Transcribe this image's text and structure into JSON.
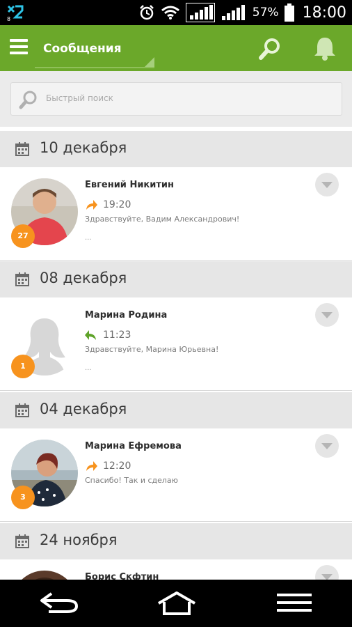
{
  "status_bar": {
    "battery_percent": "57%",
    "time": "18:00"
  },
  "app_bar": {
    "title": "Сообщения",
    "color": "#6ba82a"
  },
  "quick_search": {
    "placeholder": "Быстрый поиск"
  },
  "accent_color": "#f7931e",
  "groups": [
    {
      "date": "10 декабря",
      "message": {
        "name": "Евгений Никитин",
        "direction": "outgoing",
        "time": "19:20",
        "preview": "Здравствуйте, Вадим Александрович!",
        "ellipsis": "...",
        "badge": "27"
      }
    },
    {
      "date": "08 декабря",
      "message": {
        "name": "Марина Родина",
        "direction": "incoming",
        "time": "11:23",
        "preview": "Здравствуйте, Марина Юрьевна!",
        "ellipsis": "...",
        "badge": "1"
      }
    },
    {
      "date": "04 декабря",
      "message": {
        "name": "Марина Ефремова",
        "direction": "outgoing",
        "time": "12:20",
        "preview": "Спасибо! Так и сделаю",
        "badge": "3"
      }
    },
    {
      "date": "24 ноября",
      "message": {
        "name": "Борис Скфтин"
      }
    }
  ]
}
